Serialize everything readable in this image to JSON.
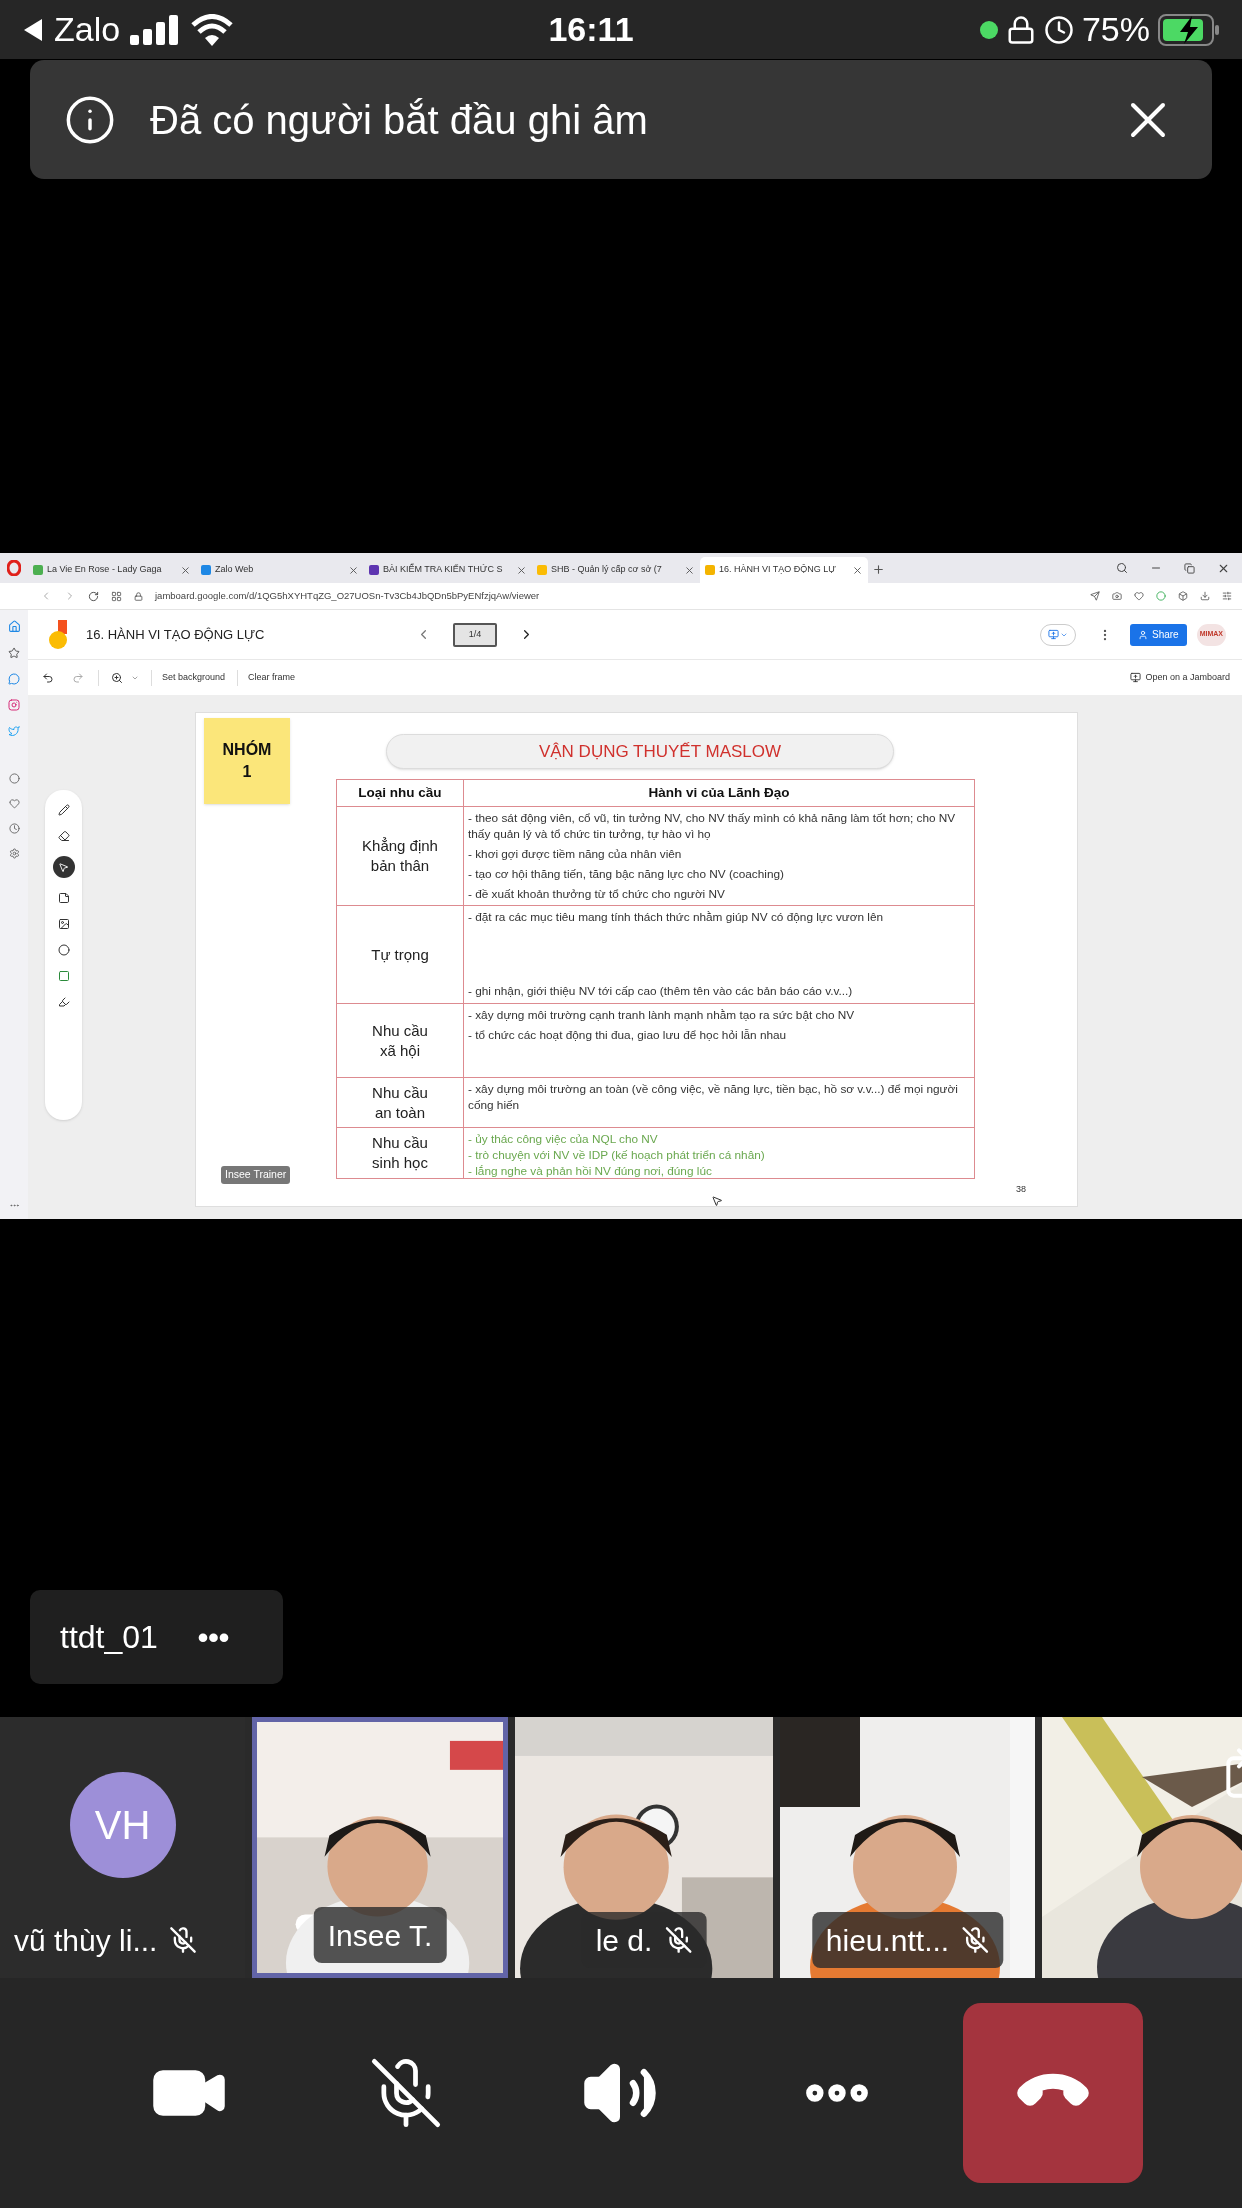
{
  "status_bar": {
    "back_app": "Zalo",
    "time": "16:11",
    "battery": "75%"
  },
  "notification": {
    "text": "Đã có người bắt đầu ghi âm"
  },
  "browser": {
    "tabs": [
      {
        "title": "La Vie En Rose - Lady Gaga",
        "selected": false
      },
      {
        "title": "Zalo Web",
        "selected": false
      },
      {
        "title": "BÀI KIỂM TRA KIẾN THỨC S",
        "selected": false
      },
      {
        "title": "SHB - Quản lý cấp cơ sở (7",
        "selected": false
      },
      {
        "title": "16. HÀNH VI TẠO ĐỘNG LỰ",
        "selected": true
      }
    ],
    "url": "jamboard.google.com/d/1QG5hXYHTqZG_O27UOSn-Tv3Cb4JbQDn5bPyENfzjqAw/viewer",
    "jamboard": {
      "title": "16. HÀNH VI TẠO ĐỘNG LỰC",
      "frame_counter": "1/4",
      "share": "Share",
      "avatar_label": "MIMAX",
      "toolbar": [
        "Set background",
        "Clear frame"
      ],
      "open_button": "Open on a Jamboard"
    },
    "slide": {
      "sticky_note": [
        "NHÓM",
        "1"
      ],
      "title": "VẬN DỤNG THUYẾT MASLOW",
      "columns": [
        "Loại nhu cầu",
        "Hành vi của Lãnh Đạo"
      ],
      "rows": [
        {
          "need": [
            "Khẳng định",
            "bản thân"
          ],
          "kind": "stack",
          "behaviors": [
            {
              "text": "- theo sát động viên, cổ vũ, tin tưởng NV, cho NV thấy mình có khả năng làm tốt hơn; cho NV thấy quản lý và tổ chức tin tưởng, tự hào vì họ",
              "color": "#333333"
            },
            {
              "text": "- khơi gợi được tiềm năng của nhân viên",
              "color": "#333333"
            },
            {
              "text": "- tạo cơ hội thăng tiến, tăng bậc năng lực cho NV (coaching)",
              "color": "#333333"
            },
            {
              "text": "- đề xuất khoản thưởng từ tổ chức cho người NV",
              "color": "#333333"
            }
          ]
        },
        {
          "need": [
            "Tự trọng"
          ],
          "kind": "spread",
          "behaviors": [
            {
              "text": "- đặt ra các mục tiêu mang tính thách thức nhằm giúp NV có động lực vươn lên",
              "color": "#333333"
            },
            {
              "text": "- ghi nhận, giới thiệu NV tới cấp cao (thêm tên vào các bản báo cáo v.v...)",
              "color": "#333333"
            }
          ]
        },
        {
          "need": [
            "Nhu cầu",
            "xã hội"
          ],
          "kind": "stack",
          "behaviors": [
            {
              "text": "- xây dựng môi trường cạnh tranh lành mạnh nhằm tạo ra sức bật cho NV",
              "color": "#333333"
            },
            {
              "text": "- tổ chức các hoạt động thi đua, giao lưu để học hỏi lẫn nhau",
              "color": "#333333"
            }
          ]
        },
        {
          "need": [
            "Nhu cầu",
            "an toàn"
          ],
          "kind": "stack",
          "behaviors": [
            {
              "text": "- xây dựng môi trường an toàn (về công việc, về năng lực, tiền bạc, hồ sơ v.v...) để mọi người cống hiến",
              "color": "#333333"
            }
          ]
        },
        {
          "need": [
            "Nhu cầu",
            "sinh học"
          ],
          "kind": "tight",
          "behaviors": [
            {
              "text": "- ủy thác công việc của NQL cho NV",
              "color": "#6aa84f"
            },
            {
              "text": "- trò chuyện với NV về IDP (kế hoạch phát triển cá nhân)",
              "color": "#6aa84f"
            },
            {
              "text": "- lắng nghe và phản hồi NV đúng nơi, đúng lúc",
              "color": "#6aa84f"
            }
          ]
        }
      ],
      "trainer_label": "Insee Trainer",
      "page_number": "38"
    }
  },
  "speaker": {
    "name": "ttdt_01",
    "more": "•••"
  },
  "participants": [
    {
      "kind": "avatar",
      "initials": "VH",
      "name": "vũ thùy li...",
      "muted": true,
      "selected": false
    },
    {
      "kind": "video",
      "name": "Insee T.",
      "muted": false,
      "selected": true
    },
    {
      "kind": "video",
      "name": "le d.",
      "muted": true,
      "selected": false
    },
    {
      "kind": "video",
      "name": "hieu.ntt...",
      "muted": true,
      "selected": false
    },
    {
      "kind": "video",
      "selected": false
    }
  ],
  "controls": {
    "mic_muted": true
  }
}
